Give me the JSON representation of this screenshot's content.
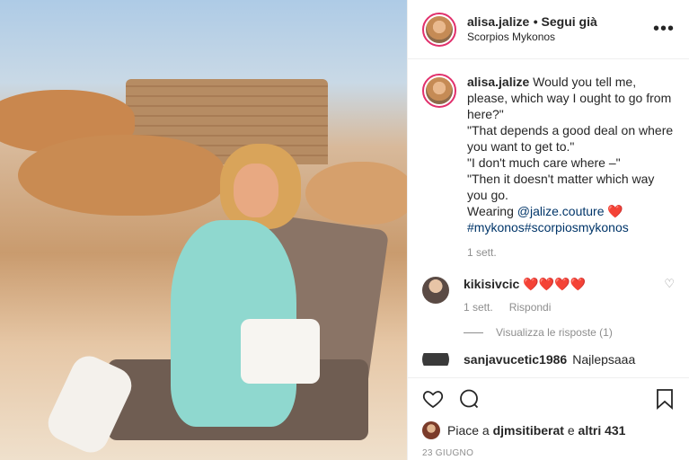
{
  "header": {
    "username": "alisa.jalize",
    "follow_label": "• Segui già",
    "location": "Scorpios Mykonos"
  },
  "caption": {
    "username": "alisa.jalize",
    "lines": [
      "Would you tell me, please, which way I ought to go from here?\"",
      "\"That depends a good deal on where you want to get to.\"",
      "\"I don't much care where –\"",
      "\"Then it doesn't matter which way you go."
    ],
    "wearing_prefix": "Wearing",
    "mention": "@jalize.couture",
    "heart": "❤️",
    "hashtags": "#mykonos#scorpiosmykonos",
    "time": "1 sett."
  },
  "comments": [
    {
      "username": "kikisivcic",
      "text": "❤️❤️❤️❤️",
      "time": "1 sett.",
      "reply_label": "Rispondi",
      "view_replies": "Visualizza le risposte (1)"
    },
    {
      "username": "sanjavucetic1986",
      "text": "Najlepsaaa"
    }
  ],
  "likes": {
    "prefix": "Piace a",
    "user": "djmsitiberat",
    "suffix": "e",
    "others": "altri 431"
  },
  "date": "23 GIUGNO",
  "colors": {
    "link": "#003569",
    "heart": "#ed4956",
    "muted": "#8e8e8e"
  }
}
